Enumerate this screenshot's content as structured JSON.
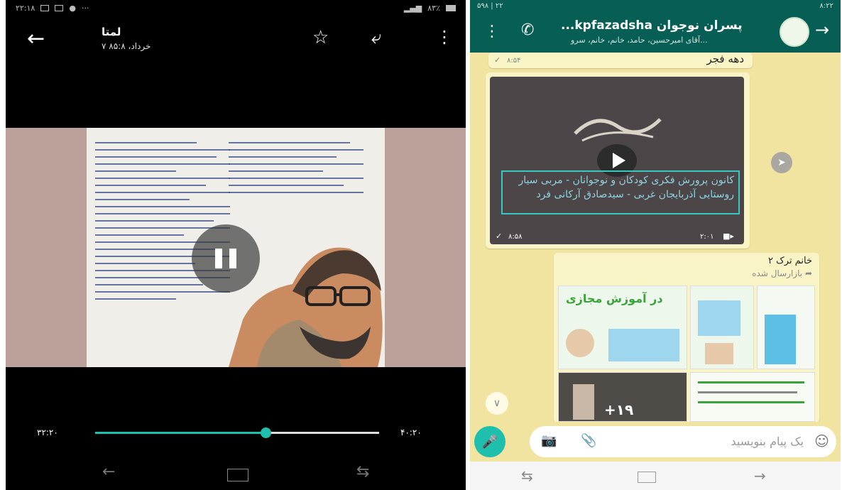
{
  "viewer": {
    "status": {
      "left": "۲۲:۱۸",
      "right": "۸۳٪"
    },
    "title": "لمتا",
    "subtitle": "۷ خرداد، ۸۵:۸",
    "progress": {
      "elapsed": "۳۲:۲۰",
      "total": "۴۰:۲۰",
      "fraction": 0.6
    }
  },
  "chat": {
    "status": {
      "left": "۵۹۸ ‎|‎ ۲۲",
      "right": "۸:۲۲"
    },
    "title": "...kpfazadsha پسران نوجوان",
    "subtitle": "آقای امیرحسین، حامد، خانم، خانم، سرو...",
    "top_text": "دهه فجر",
    "top_time": "۸:۵۴",
    "video_caption": "کانون پرورش فکری کودکان و نوجوانان - مربی سیار روستایی آذربایجان غربی - سیدصادق آرکانی فرد",
    "video_duration": "۲:۰۱",
    "video_time": "۸:۵۸",
    "sender": "خانم ترک ۲",
    "forwarded": "بازارسال شده",
    "grid_title": "در آموزش مجازی",
    "grid_more": "+۱۹",
    "placeholder": "یک پیام بنویسید"
  }
}
